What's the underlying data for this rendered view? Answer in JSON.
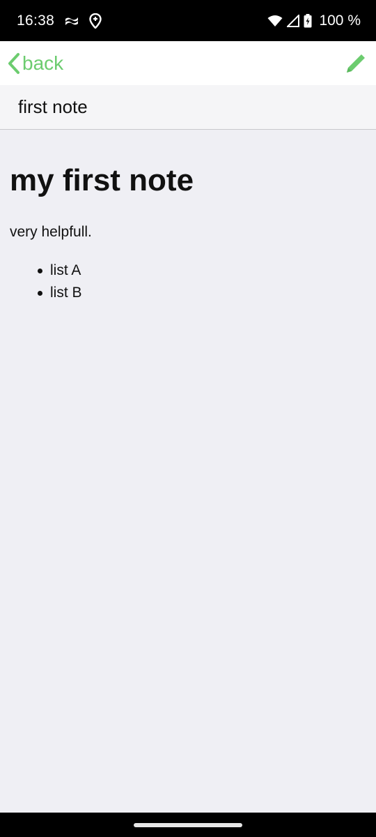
{
  "status_bar": {
    "time": "16:38",
    "battery": "100 %",
    "icons": [
      "hotspot-icon",
      "location-icon",
      "wifi-icon",
      "signal-icon",
      "battery-charging-icon"
    ]
  },
  "toolbar": {
    "back_label": "back",
    "accent_color": "#6ccc6f",
    "edit_icon": "pencil-icon"
  },
  "title_bar": {
    "title": "first note"
  },
  "note": {
    "heading": "my first note",
    "paragraph": "very helpfull.",
    "list_items": [
      "list A",
      "list B"
    ]
  }
}
